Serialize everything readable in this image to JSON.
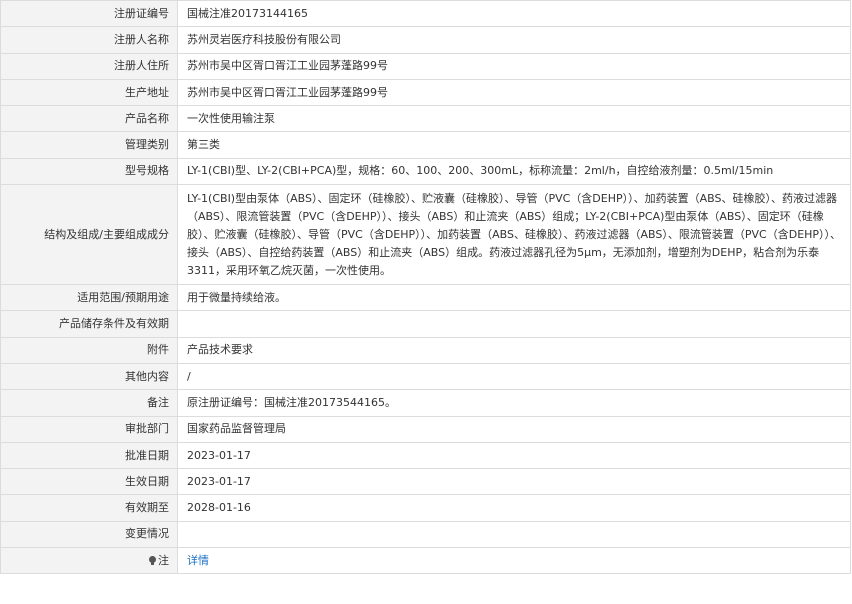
{
  "rows": [
    {
      "label": "注册证编号",
      "value": "国械注准20173144165"
    },
    {
      "label": "注册人名称",
      "value": "苏州灵岩医疗科技股份有限公司"
    },
    {
      "label": "注册人住所",
      "value": "苏州市吴中区胥口胥江工业园茅蓬路99号"
    },
    {
      "label": "生产地址",
      "value": "苏州市吴中区胥口胥江工业园茅蓬路99号"
    },
    {
      "label": "产品名称",
      "value": "一次性使用输注泵"
    },
    {
      "label": "管理类别",
      "value": "第三类"
    },
    {
      "label": "型号规格",
      "value": "LY-1(CBI)型、LY-2(CBI+PCA)型，规格：60、100、200、300mL，标称流量：2ml/h，自控给液剂量：0.5ml/15min"
    },
    {
      "label": "结构及组成/主要组成成分",
      "value": "LY-1(CBI)型由泵体（ABS）、固定环（硅橡胶）、贮液囊（硅橡胶）、导管（PVC（含DEHP））、加药装置（ABS、硅橡胶）、药液过滤器（ABS）、限流管装置（PVC（含DEHP））、接头（ABS）和止流夹（ABS）组成；LY-2(CBI+PCA)型由泵体（ABS）、固定环（硅橡胶）、贮液囊（硅橡胶）、导管（PVC（含DEHP））、加药装置（ABS、硅橡胶）、药液过滤器（ABS）、限流管装置（PVC（含DEHP））、接头（ABS）、自控给药装置（ABS）和止流夹（ABS）组成。药液过滤器孔径为5μm，无添加剂，增塑剂为DEHP，粘合剂为乐泰3311，采用环氧乙烷灭菌，一次性使用。"
    },
    {
      "label": "适用范围/预期用途",
      "value": "用于微量持续给液。"
    },
    {
      "label": "产品储存条件及有效期",
      "value": ""
    },
    {
      "label": "附件",
      "value": "产品技术要求"
    },
    {
      "label": "其他内容",
      "value": "/"
    },
    {
      "label": "备注",
      "value": "原注册证编号：国械注准20173544165。"
    },
    {
      "label": "审批部门",
      "value": "国家药品监督管理局"
    },
    {
      "label": "批准日期",
      "value": "2023-01-17"
    },
    {
      "label": "生效日期",
      "value": "2023-01-17"
    },
    {
      "label": "有效期至",
      "value": "2028-01-16"
    },
    {
      "label": "变更情况",
      "value": ""
    }
  ],
  "note": {
    "label": "注",
    "icon": "lightbulb-icon",
    "link_text": "详情",
    "link_color": "#1a6fc4"
  }
}
